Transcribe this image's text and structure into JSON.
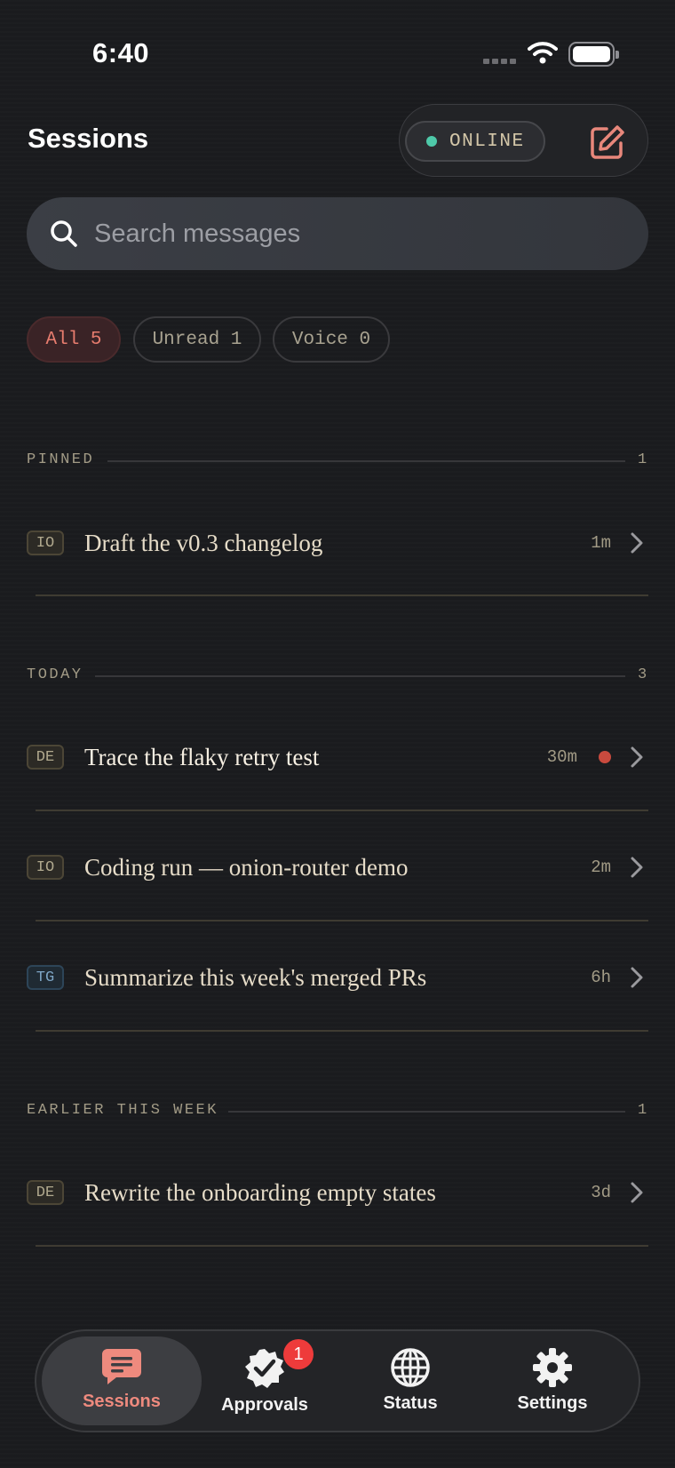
{
  "status_bar": {
    "time": "6:40"
  },
  "header": {
    "title": "Sessions",
    "connection_status": "ONLINE",
    "status_color": "#4ec9a9",
    "accent_color": "#ee8a7e"
  },
  "search": {
    "placeholder": "Search messages"
  },
  "filters": [
    {
      "label": "All 5",
      "active": true
    },
    {
      "label": "Unread 1",
      "active": false
    },
    {
      "label": "Voice 0",
      "active": false
    }
  ],
  "sections": [
    {
      "label": "PINNED",
      "count": "1",
      "rows": [
        {
          "tag": "IO",
          "title": "Draft the v0.3 changelog",
          "time": "1m",
          "unread": false
        }
      ]
    },
    {
      "label": "TODAY",
      "count": "3",
      "rows": [
        {
          "tag": "DE",
          "title": "Trace the flaky retry test",
          "time": "30m",
          "unread": true
        },
        {
          "tag": "IO",
          "title": "Coding run — onion-router demo",
          "time": "2m",
          "unread": false
        },
        {
          "tag": "TG",
          "title": "Summarize this week's merged PRs",
          "time": "6h",
          "unread": false
        }
      ]
    },
    {
      "label": "EARLIER THIS WEEK",
      "count": "1",
      "rows": [
        {
          "tag": "DE",
          "title": "Rewrite the onboarding empty states",
          "time": "3d",
          "unread": false
        }
      ]
    }
  ],
  "tabbar": {
    "tabs": [
      {
        "label": "Sessions",
        "icon": "chat-bubble-icon",
        "active": true
      },
      {
        "label": "Approvals",
        "icon": "checkmark-seal-icon",
        "active": false,
        "badge": "1"
      },
      {
        "label": "Status",
        "icon": "globe-icon",
        "active": false
      },
      {
        "label": "Settings",
        "icon": "gear-icon",
        "active": false
      }
    ]
  }
}
